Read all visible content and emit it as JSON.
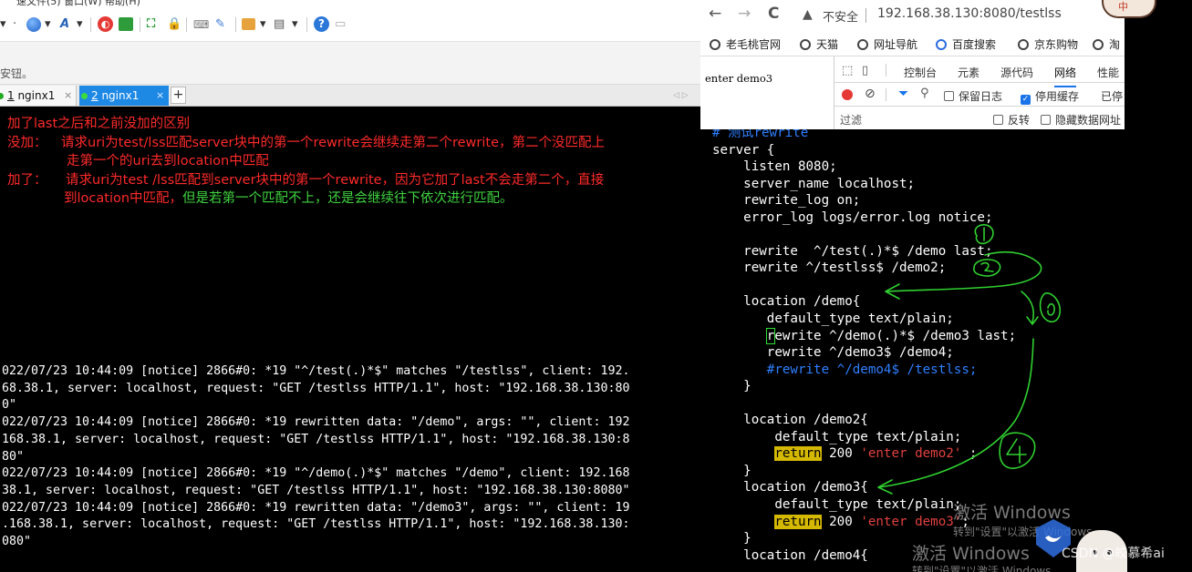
{
  "terminal": {
    "menu_fragment": "速文件(5)  窗口(W)  帮助(H)",
    "hint": "安钮。",
    "tabs": [
      {
        "num": "1",
        "label": " nginx1"
      },
      {
        "num": "2",
        "label": " nginx1"
      }
    ],
    "tab_close": "×",
    "tab_add": "+",
    "tab_nav": "◁ ▷",
    "annotation": {
      "title": "加了last之后和之前没加的区别",
      "without_label": "没加：",
      "without_line1": "请求uri为test/lss匹配server块中的第一个rewrite会继续走第二个rewrite，第二个没匹配上",
      "without_line2": "走第一个的uri去到location中匹配",
      "with_label": "加了：",
      "with_line1": "请求uri为test /lss匹配到server块中的第一个rewrite，因为它加了last不会走第二个，直接",
      "with_line2_red": "到location中匹配，",
      "with_line2_green": "但是若第一个匹配不上，还是会继续往下依次进行匹配。"
    },
    "log_lines": [
      "022/07/23 10:44:09 [notice] 2866#0: *19 \"^/test(.)*$\" matches \"/testlss\", client: 192.",
      "68.38.1, server: localhost, request: \"GET /testlss HTTP/1.1\", host: \"192.168.38.130:80",
      "0\"",
      "022/07/23 10:44:09 [notice] 2866#0: *19 rewritten data: \"/demo\", args: \"\", client: 192",
      "168.38.1, server: localhost, request: \"GET /testlss HTTP/1.1\", host: \"192.168.38.130:8",
      "80\"",
      "022/07/23 10:44:09 [notice] 2866#0: *19 \"^/demo(.)*$\" matches \"/demo\", client: 192.168",
      "38.1, server: localhost, request: \"GET /testlss HTTP/1.1\", host: \"192.168.38.130:8080\"",
      "022/07/23 10:44:09 [notice] 2866#0: *19 rewritten data: \"/demo3\", args: \"\", client: 19",
      ".168.38.1, server: localhost, request: \"GET /testlss HTTP/1.1\", host: \"192.168.38.130:",
      "080\""
    ]
  },
  "browser": {
    "back": "←",
    "forward": "→",
    "reload": "C",
    "warning_icon": "warning-triangle",
    "insecure_label": "不安全",
    "url": "192.168.38.130:8080/testlss",
    "bookmarks": [
      "老毛桃官网",
      "天猫",
      "网址导航",
      "百度搜索",
      "京东购物",
      "淘"
    ],
    "page_text": "enter demo3",
    "devtools": {
      "tabs": [
        "控制台",
        "元素",
        "源代码",
        "网络",
        "性能"
      ],
      "active_tab": "网络",
      "preserve_log": "保留日志",
      "disable_cache": "停用缓存",
      "disable_cache_checked": true,
      "overflow": "已停",
      "filter_placeholder": "过滤",
      "invert": "反转",
      "hide_data_urls": "隐藏数据网址"
    }
  },
  "vim": {
    "comment": "# 测试rewrite",
    "lines": {
      "server": "server {",
      "listen": "    listen 8080;",
      "server_name": "    server_name localhost;",
      "rewrite_log": "    rewrite_log on;",
      "error_log": "    error_log logs/error.log notice;",
      "rw1": "    rewrite  ^/test(.)*$ /demo last;",
      "rw2": "    rewrite ^/testlss$ /demo2;",
      "loc_demo": "    location /demo{",
      "dt1": "       default_type text/plain;",
      "rw3_rest": "ewrite ^/demo(.)*$ /demo3 last;",
      "rw3_first": "r",
      "rw4": "       rewrite ^/demo3$ /demo4;",
      "rw5_commented": "       #rewrite ^/demo4$ /testlss;",
      "close1": "    }",
      "loc_demo2": "    location /demo2{",
      "dt2": "        default_type text/plain;",
      "ret_kw": "return",
      "ret2_num": " 200 ",
      "ret2_str": "'enter demo2'",
      "ret2_end": " ;",
      "close2": "    }",
      "loc_demo3": "    location /demo3{",
      "dt3": "        default_type text/plain;",
      "ret3_num": " 200 ",
      "ret3_str": "'enter demo3'",
      "ret3_end": ";",
      "close3": "    }",
      "loc_demo4": "    location /demo4{"
    },
    "handwritten_labels": [
      "1",
      "2",
      "3",
      "4"
    ]
  },
  "overlay": {
    "activate_title": "激活 Windows",
    "activate_sub": "转到\"设置\"以激活 Windows。",
    "activate_title2": "激活 Windows",
    "activate_sub2": "转到\"设置\"以激活 Windows",
    "csdn": "CSDN @皎慕希ai",
    "sticker_text": "中"
  },
  "colors": {
    "annotation_red": "#ff2a2a",
    "annotation_green": "#3fd33f",
    "comment_blue": "#2f7fff",
    "string_red": "#e04040",
    "return_highlight": "#d5b800",
    "handwriting_green": "#30d030",
    "active_tab_blue": "#1e88e5"
  }
}
